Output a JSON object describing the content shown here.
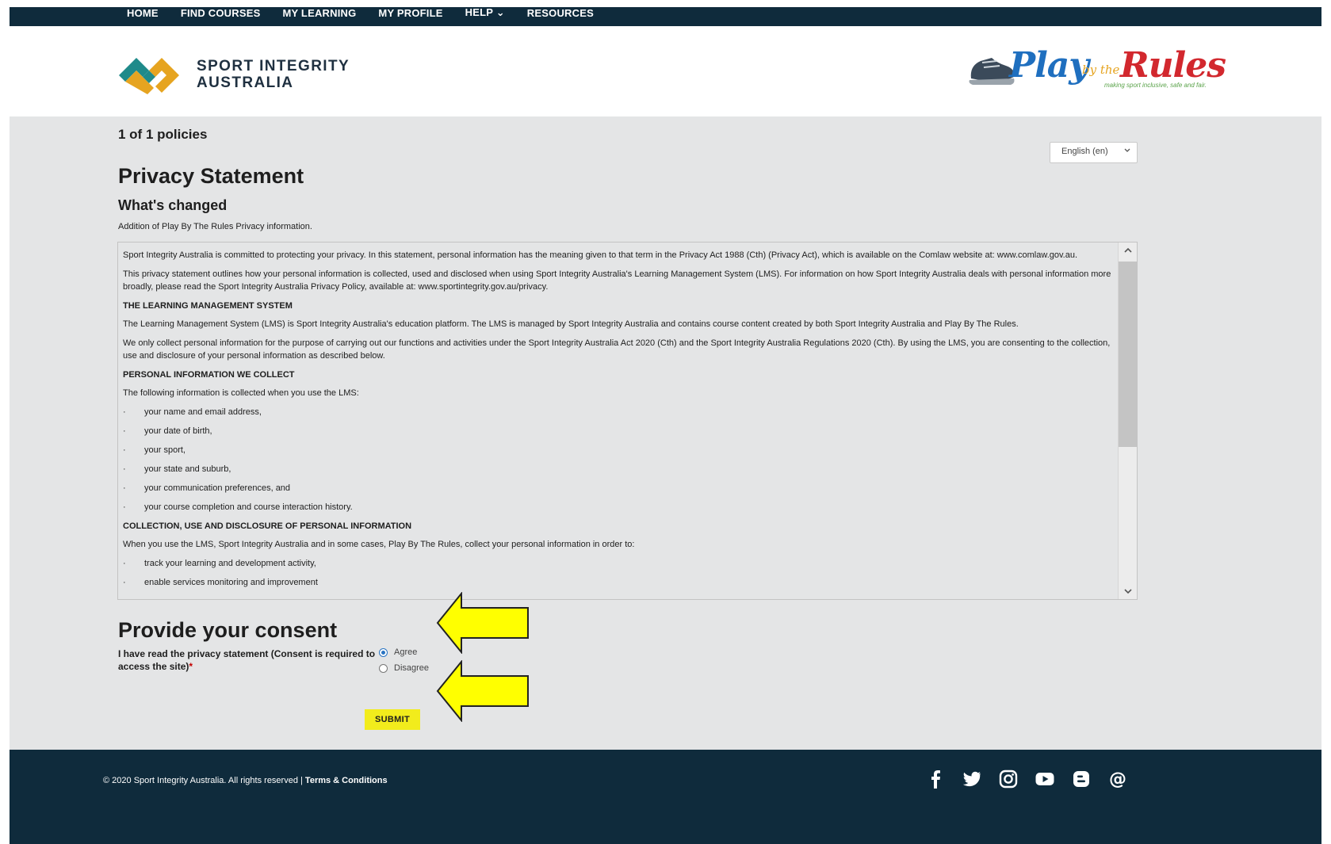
{
  "nav": {
    "items": [
      {
        "label": "HOME"
      },
      {
        "label": "FIND COURSES"
      },
      {
        "label": "MY LEARNING"
      },
      {
        "label": "MY PROFILE"
      },
      {
        "label": "HELP"
      },
      {
        "label": "RESOURCES"
      }
    ]
  },
  "brand": {
    "line1": "SPORT INTEGRITY",
    "line2": "AUSTRALIA",
    "partner_play": "Play",
    "partner_bythe": "by the",
    "partner_rules": "Rules",
    "partner_tagline": "making sport inclusive, safe and fair."
  },
  "policy_count": "1 of 1 policies",
  "language_select": {
    "value": "English (en)"
  },
  "policy": {
    "title": "Privacy Statement",
    "changed_heading": "What's changed",
    "changed_text": "Addition of Play By The Rules Privacy information.",
    "p1": "Sport Integrity Australia is committed to protecting your privacy. In this statement, personal information has the meaning given to that term in the Privacy Act 1988 (Cth) (Privacy Act), which is available on the Comlaw website at: www.comlaw.gov.au.",
    "p2": "This privacy statement outlines how your personal information is collected, used and disclosed when using Sport Integrity Australia's Learning Management System (LMS). For information on how Sport Integrity Australia deals with personal information more broadly, please read the Sport Integrity Australia Privacy Policy, available at: www.sportintegrity.gov.au/privacy.",
    "h1": "THE LEARNING MANAGEMENT SYSTEM",
    "p3": "The Learning Management System (LMS) is Sport Integrity Australia's education platform. The LMS is managed by Sport Integrity Australia and contains course content created by both Sport Integrity Australia and Play By The Rules.",
    "p4": "We only collect personal information for the purpose of carrying out our functions and activities under the Sport Integrity Australia Act 2020 (Cth) and the Sport Integrity Australia Regulations 2020 (Cth). By using the LMS, you are consenting to the collection, use and disclosure of your personal information as described below.",
    "h2": "PERSONAL INFORMATION WE COLLECT",
    "p5": "The following information is collected when you use the LMS:",
    "collect_items": [
      "your name and email address,",
      "your date of birth,",
      "your sport,",
      "your state and suburb,",
      "your communication preferences, and",
      "your course completion and course interaction history."
    ],
    "h3": "COLLECTION, USE AND DISCLOSURE OF PERSONAL INFORMATION",
    "p6": "When you use the LMS, Sport Integrity Australia and in some cases, Play By The Rules, collect your personal information in order to:",
    "use_items": [
      "track your learning and development activity,",
      "enable services monitoring and improvement"
    ],
    "bullet": "·"
  },
  "consent": {
    "title": "Provide your consent",
    "label": "I have read the privacy statement (Consent is required to access the site)",
    "required_mark": "*",
    "options": [
      {
        "label": "Agree",
        "selected": true
      },
      {
        "label": "Disagree",
        "selected": false
      }
    ],
    "submit_label": "SUBMIT"
  },
  "footer": {
    "copyright": "© 2020 Sport Integrity Australia. All rights reserved | ",
    "terms": "Terms & Conditions",
    "social_icons": [
      "facebook-icon",
      "twitter-icon",
      "instagram-icon",
      "youtube-icon",
      "blog-icon",
      "email-icon"
    ]
  },
  "colors": {
    "nav_bg": "#0f2b3c",
    "page_bg": "#e4e5e6",
    "submit_bg": "#f2ec1c",
    "arrow_fill": "#ffff00",
    "radio_accent": "#2a74c2"
  }
}
